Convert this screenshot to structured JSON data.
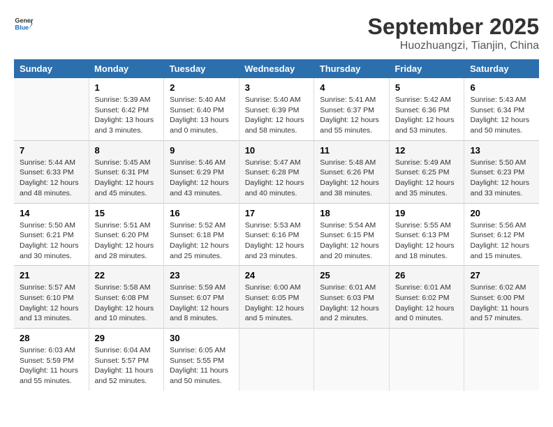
{
  "header": {
    "logo_line1": "General",
    "logo_line2": "Blue",
    "month": "September 2025",
    "location": "Huozhuangzi, Tianjin, China"
  },
  "days_of_week": [
    "Sunday",
    "Monday",
    "Tuesday",
    "Wednesday",
    "Thursday",
    "Friday",
    "Saturday"
  ],
  "weeks": [
    [
      {
        "day": "",
        "info": ""
      },
      {
        "day": "1",
        "info": "Sunrise: 5:39 AM\nSunset: 6:42 PM\nDaylight: 13 hours\nand 3 minutes."
      },
      {
        "day": "2",
        "info": "Sunrise: 5:40 AM\nSunset: 6:40 PM\nDaylight: 13 hours\nand 0 minutes."
      },
      {
        "day": "3",
        "info": "Sunrise: 5:40 AM\nSunset: 6:39 PM\nDaylight: 12 hours\nand 58 minutes."
      },
      {
        "day": "4",
        "info": "Sunrise: 5:41 AM\nSunset: 6:37 PM\nDaylight: 12 hours\nand 55 minutes."
      },
      {
        "day": "5",
        "info": "Sunrise: 5:42 AM\nSunset: 6:36 PM\nDaylight: 12 hours\nand 53 minutes."
      },
      {
        "day": "6",
        "info": "Sunrise: 5:43 AM\nSunset: 6:34 PM\nDaylight: 12 hours\nand 50 minutes."
      }
    ],
    [
      {
        "day": "7",
        "info": "Sunrise: 5:44 AM\nSunset: 6:33 PM\nDaylight: 12 hours\nand 48 minutes."
      },
      {
        "day": "8",
        "info": "Sunrise: 5:45 AM\nSunset: 6:31 PM\nDaylight: 12 hours\nand 45 minutes."
      },
      {
        "day": "9",
        "info": "Sunrise: 5:46 AM\nSunset: 6:29 PM\nDaylight: 12 hours\nand 43 minutes."
      },
      {
        "day": "10",
        "info": "Sunrise: 5:47 AM\nSunset: 6:28 PM\nDaylight: 12 hours\nand 40 minutes."
      },
      {
        "day": "11",
        "info": "Sunrise: 5:48 AM\nSunset: 6:26 PM\nDaylight: 12 hours\nand 38 minutes."
      },
      {
        "day": "12",
        "info": "Sunrise: 5:49 AM\nSunset: 6:25 PM\nDaylight: 12 hours\nand 35 minutes."
      },
      {
        "day": "13",
        "info": "Sunrise: 5:50 AM\nSunset: 6:23 PM\nDaylight: 12 hours\nand 33 minutes."
      }
    ],
    [
      {
        "day": "14",
        "info": "Sunrise: 5:50 AM\nSunset: 6:21 PM\nDaylight: 12 hours\nand 30 minutes."
      },
      {
        "day": "15",
        "info": "Sunrise: 5:51 AM\nSunset: 6:20 PM\nDaylight: 12 hours\nand 28 minutes."
      },
      {
        "day": "16",
        "info": "Sunrise: 5:52 AM\nSunset: 6:18 PM\nDaylight: 12 hours\nand 25 minutes."
      },
      {
        "day": "17",
        "info": "Sunrise: 5:53 AM\nSunset: 6:16 PM\nDaylight: 12 hours\nand 23 minutes."
      },
      {
        "day": "18",
        "info": "Sunrise: 5:54 AM\nSunset: 6:15 PM\nDaylight: 12 hours\nand 20 minutes."
      },
      {
        "day": "19",
        "info": "Sunrise: 5:55 AM\nSunset: 6:13 PM\nDaylight: 12 hours\nand 18 minutes."
      },
      {
        "day": "20",
        "info": "Sunrise: 5:56 AM\nSunset: 6:12 PM\nDaylight: 12 hours\nand 15 minutes."
      }
    ],
    [
      {
        "day": "21",
        "info": "Sunrise: 5:57 AM\nSunset: 6:10 PM\nDaylight: 12 hours\nand 13 minutes."
      },
      {
        "day": "22",
        "info": "Sunrise: 5:58 AM\nSunset: 6:08 PM\nDaylight: 12 hours\nand 10 minutes."
      },
      {
        "day": "23",
        "info": "Sunrise: 5:59 AM\nSunset: 6:07 PM\nDaylight: 12 hours\nand 8 minutes."
      },
      {
        "day": "24",
        "info": "Sunrise: 6:00 AM\nSunset: 6:05 PM\nDaylight: 12 hours\nand 5 minutes."
      },
      {
        "day": "25",
        "info": "Sunrise: 6:01 AM\nSunset: 6:03 PM\nDaylight: 12 hours\nand 2 minutes."
      },
      {
        "day": "26",
        "info": "Sunrise: 6:01 AM\nSunset: 6:02 PM\nDaylight: 12 hours\nand 0 minutes."
      },
      {
        "day": "27",
        "info": "Sunrise: 6:02 AM\nSunset: 6:00 PM\nDaylight: 11 hours\nand 57 minutes."
      }
    ],
    [
      {
        "day": "28",
        "info": "Sunrise: 6:03 AM\nSunset: 5:59 PM\nDaylight: 11 hours\nand 55 minutes."
      },
      {
        "day": "29",
        "info": "Sunrise: 6:04 AM\nSunset: 5:57 PM\nDaylight: 11 hours\nand 52 minutes."
      },
      {
        "day": "30",
        "info": "Sunrise: 6:05 AM\nSunset: 5:55 PM\nDaylight: 11 hours\nand 50 minutes."
      },
      {
        "day": "",
        "info": ""
      },
      {
        "day": "",
        "info": ""
      },
      {
        "day": "",
        "info": ""
      },
      {
        "day": "",
        "info": ""
      }
    ]
  ]
}
